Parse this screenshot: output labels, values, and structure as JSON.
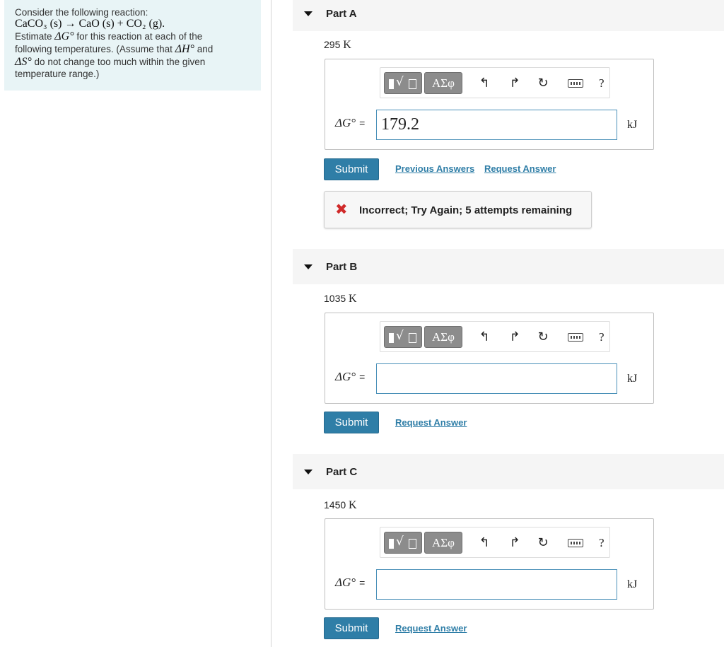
{
  "problem": {
    "intro": "Consider the following reaction:",
    "reaction": "CaCO₃ (s) → CaO (s) + CO₂ (g).",
    "line1_pre": "Estimate ",
    "line1_sym": "ΔG°",
    "line1_post": " for this reaction at each of the",
    "line2_pre": "following temperatures. (Assume that ",
    "line2_sym": "ΔH°",
    "line2_post": " and",
    "line3_sym": "ΔS°",
    "line3_post": " do not change too much within the given",
    "line4": "temperature range.)"
  },
  "toolbar": {
    "greek_label": "ΑΣφ",
    "undo_icon": "undo-arrow",
    "redo_icon": "redo-arrow",
    "reset_icon": "reset-circle",
    "keyboard_icon": "keyboard",
    "help_label": "?"
  },
  "parts": [
    {
      "title": "Part A",
      "temp_value": "295",
      "temp_unit": "K",
      "eq_symbol": "ΔG°",
      "eq_sign": "=",
      "answer_value": "179.2",
      "unit": "kJ",
      "submit_label": "Submit",
      "previous_answers_label": "Previous Answers",
      "request_answer_label": "Request Answer",
      "feedback": "Incorrect; Try Again; 5 attempts remaining",
      "feedback_icon": "✖"
    },
    {
      "title": "Part B",
      "temp_value": "1035",
      "temp_unit": "K",
      "eq_symbol": "ΔG°",
      "eq_sign": "=",
      "answer_value": "",
      "unit": "kJ",
      "submit_label": "Submit",
      "request_answer_label": "Request Answer"
    },
    {
      "title": "Part C",
      "temp_value": "1450",
      "temp_unit": "K",
      "eq_symbol": "ΔG°",
      "eq_sign": "=",
      "answer_value": "",
      "unit": "kJ",
      "submit_label": "Submit",
      "request_answer_label": "Request Answer"
    }
  ],
  "colors": {
    "accent": "#2f7ea7",
    "sidebar_bg": "#e8f4f6",
    "error": "#d02a2a"
  }
}
